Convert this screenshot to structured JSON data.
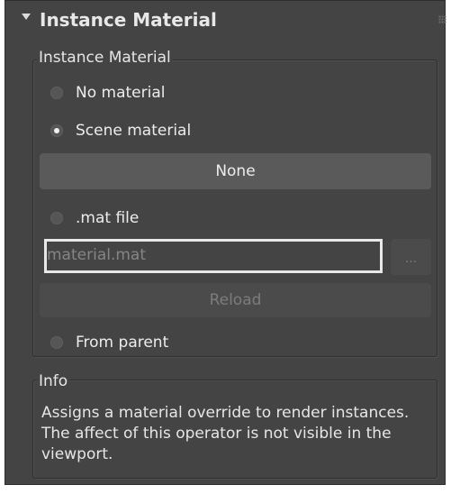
{
  "rollout": {
    "title": "Instance Material"
  },
  "instance_group": {
    "legend": "Instance Material",
    "options": [
      {
        "label": "No material",
        "checked": false
      },
      {
        "label": "Scene material",
        "checked": true
      },
      {
        "label": ".mat file",
        "checked": false
      },
      {
        "label": "From parent",
        "checked": false
      }
    ],
    "scene_material_button": "None",
    "mat_file": {
      "placeholder": "material.mat",
      "value": "",
      "browse_label": "...",
      "reload_label": "Reload"
    }
  },
  "info_group": {
    "legend": "Info",
    "text": "Assigns a material override to render instances. The affect of this operator is not visible in the viewport."
  },
  "icons": {
    "collapse": "chevron-down-icon",
    "grip": "grip-icon"
  },
  "colors": {
    "panel_bg": "#444444",
    "button_bg": "#5a5a5a",
    "text": "#ececec",
    "input_border": "#e8e8e8"
  }
}
